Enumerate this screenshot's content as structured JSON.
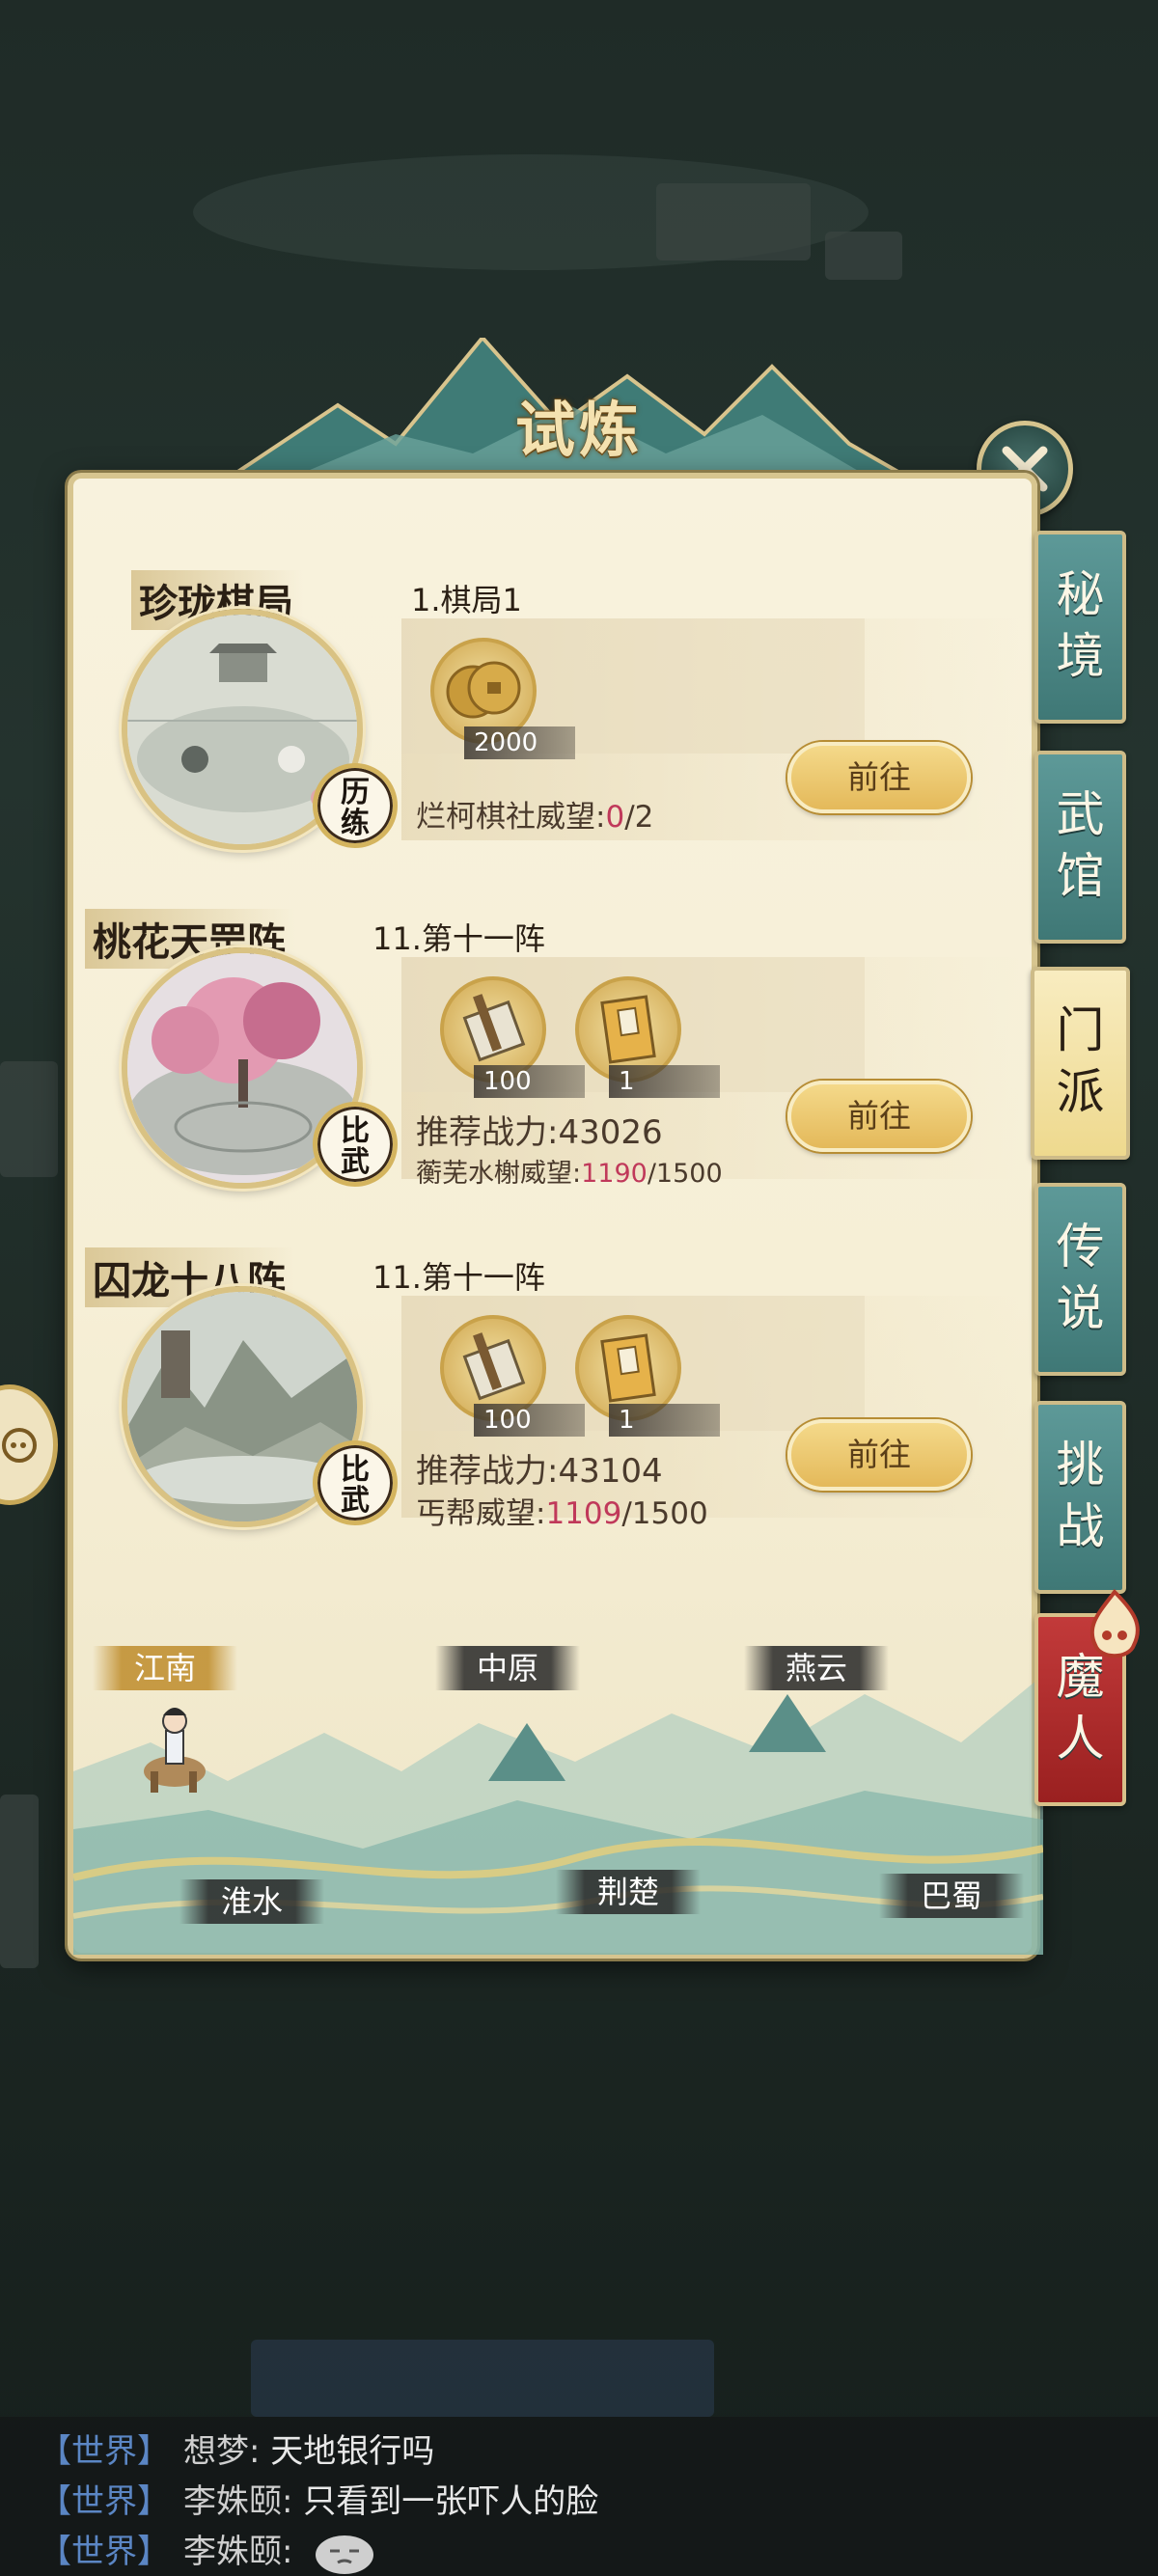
{
  "title": "试炼",
  "rows": [
    {
      "title": "珍珑棋局",
      "subtitle": "1.棋局1",
      "badge": "历练",
      "items": [
        {
          "icon": "coin-icon",
          "count": "2000"
        }
      ],
      "power_line": "",
      "reputation_label": "烂柯棋社威望:",
      "reputation_current": "0",
      "reputation_total": "/2",
      "button": "前往"
    },
    {
      "title": "桃花天罡阵",
      "subtitle": "11.第十一阵",
      "badge": "比武",
      "items": [
        {
          "icon": "scroll-icon",
          "count": "100"
        },
        {
          "icon": "book-icon",
          "count": "1"
        }
      ],
      "power_line": "推荐战力:43026",
      "reputation_label": "蘅芜水榭威望:",
      "reputation_current": "1190",
      "reputation_total": "/1500",
      "button": "前往"
    },
    {
      "title": "囚龙十八阵",
      "subtitle": "11.第十一阵",
      "badge": "比武",
      "items": [
        {
          "icon": "scroll-icon",
          "count": "100"
        },
        {
          "icon": "book-icon",
          "count": "1"
        }
      ],
      "power_line": "推荐战力:43104",
      "reputation_label": "丐帮威望:",
      "reputation_current": "1109",
      "reputation_total": "/1500",
      "button": "前往"
    }
  ],
  "map": {
    "regions": [
      "江南",
      "中原",
      "燕云",
      "淮水",
      "荆楚",
      "巴蜀"
    ],
    "active": "江南"
  },
  "side_tabs": [
    "秘境",
    "武馆",
    "门派",
    "传说",
    "挑战",
    "魔人"
  ],
  "active_tab": "门派",
  "chat": [
    {
      "channel": "【世界】",
      "name": "想梦:",
      "text": "天地银行吗"
    },
    {
      "channel": "【世界】",
      "name": "李姝颐:",
      "text": "只看到一张吓人的脸"
    },
    {
      "channel": "【世界】",
      "name": "李姝颐:",
      "text": ""
    }
  ],
  "colors": {
    "accent_gold": "#e4b95a",
    "tab_teal": "#4f8987",
    "highlight": "#c0395a"
  }
}
